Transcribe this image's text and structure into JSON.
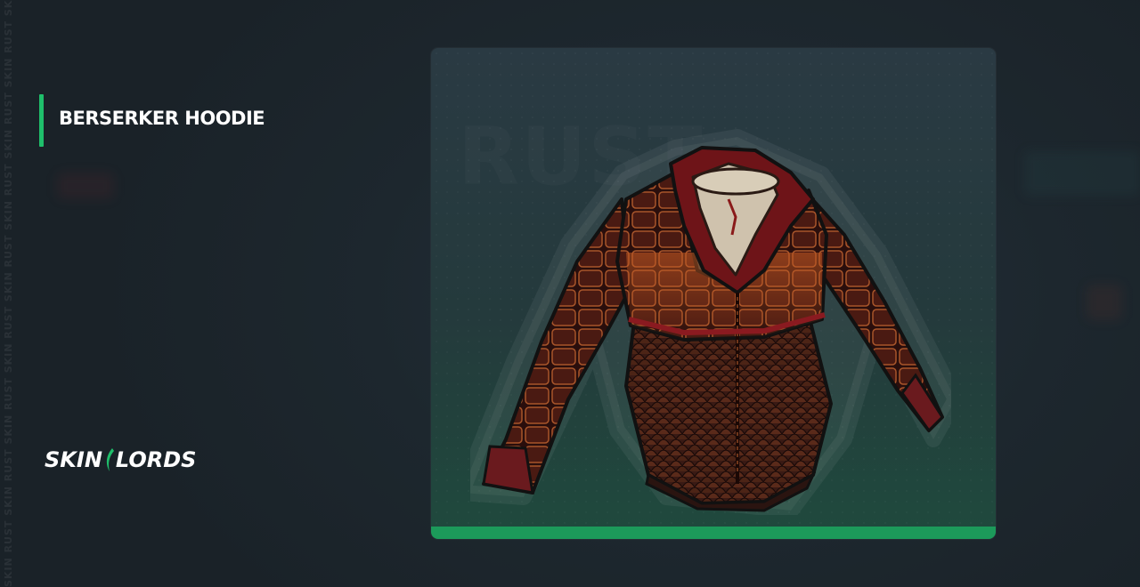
{
  "title": "BERSERKER HOODIE",
  "watermark": "SKIN RUST SKIN RUST SKIN RUST SKIN RUST SKIN RUST SKIN RUST SKIN RUST SKIN RUST SKIN RUST SKIN RUST SKIN RUST SKIN RUST SKIN RUST",
  "logo": {
    "left": "SKIN",
    "right": "LORDS"
  },
  "item_image": {
    "icon": "berserker-hoodie-icon"
  },
  "colors": {
    "accent": "#1fbf6b",
    "card_bar": "#1c9a5a",
    "background": "#1d262d",
    "hoodie_red": "#7a1a1c",
    "hoodie_gold": "#b5622a"
  }
}
